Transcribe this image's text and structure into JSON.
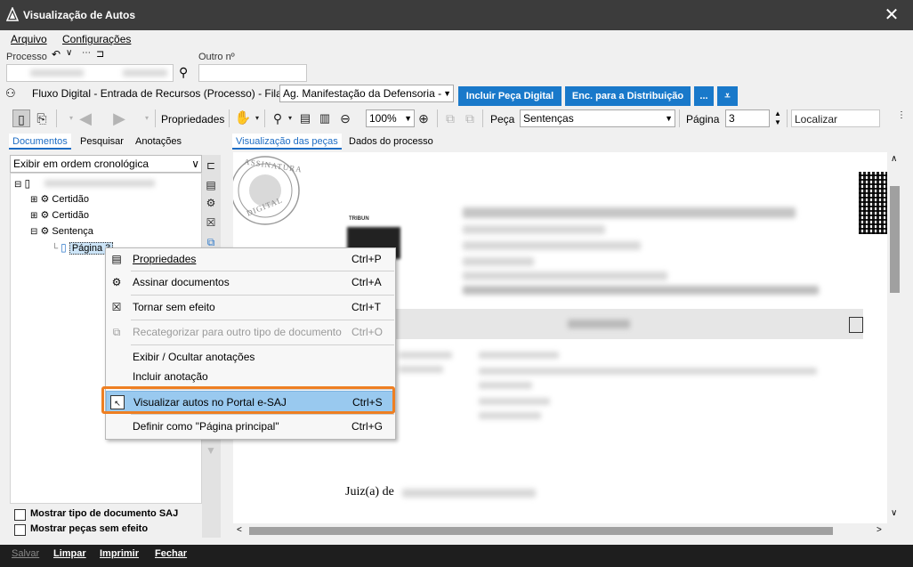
{
  "window": {
    "title": "Visualização de Autos"
  },
  "menu": [
    "Arquivo",
    "Configurações"
  ],
  "process": {
    "label": "Processo",
    "other_label": "Outro nº"
  },
  "flow": {
    "text": "Fluxo Digital - Entrada de Recursos (Processo) - Fila:",
    "queue": "Ag. Manifestação da Defensoria -",
    "btn_include": "Incluir Peça Digital",
    "btn_enc": "Enc. para a Distribuição",
    "btn_more": "..."
  },
  "toolbar": {
    "properties": "Propriedades",
    "zoom": "100%",
    "piece_label": "Peça",
    "piece_value": "Sentenças",
    "page_label": "Página",
    "page_value": "3",
    "find_placeholder": "Localizar"
  },
  "left_tabs": [
    "Documentos",
    "Pesquisar",
    "Anotações"
  ],
  "order_select": "Exibir em ordem cronológica",
  "tree": {
    "items": [
      "Certidão",
      "Certidão",
      "Sentença"
    ],
    "page_item": "Página 3"
  },
  "doc_tabs": [
    "Visualização das peças",
    "Dados do processo"
  ],
  "context_menu": [
    {
      "label": "Propriedades",
      "shortcut": "Ctrl+P",
      "icon": "properties-icon"
    },
    {
      "label": "Assinar documentos",
      "shortcut": "Ctrl+A",
      "icon": "sign-icon"
    },
    {
      "label": "Tornar sem efeito",
      "shortcut": "Ctrl+T",
      "icon": "void-icon"
    },
    {
      "label": "Recategorizar para outro tipo de documento",
      "shortcut": "Ctrl+O",
      "icon": "recategorize-icon"
    },
    {
      "label": "Exibir / Ocultar anotações",
      "shortcut": ""
    },
    {
      "label": "Incluir anotação",
      "shortcut": ""
    },
    {
      "label": "Visualizar autos no Portal e-SAJ",
      "shortcut": "Ctrl+S",
      "icon": "portal-icon"
    },
    {
      "label": "Definir como \"Página principal\"",
      "shortcut": "Ctrl+G"
    }
  ],
  "document": {
    "stamp_top": "ASSINATURA",
    "stamp_bottom": "DIGITAL",
    "tribunal_label": "TRIBUN",
    "judge": "Juiz(a) de"
  },
  "options": {
    "show_type": "Mostrar tipo de documento SAJ",
    "show_void": "Mostrar peças sem efeito"
  },
  "footer": [
    "Salvar",
    "Limpar",
    "Imprimir",
    "Fechar"
  ],
  "colors": {
    "accent": "#1979ca",
    "highlight_frame": "#ee7f22",
    "menu_highlight": "#99c9ef"
  }
}
